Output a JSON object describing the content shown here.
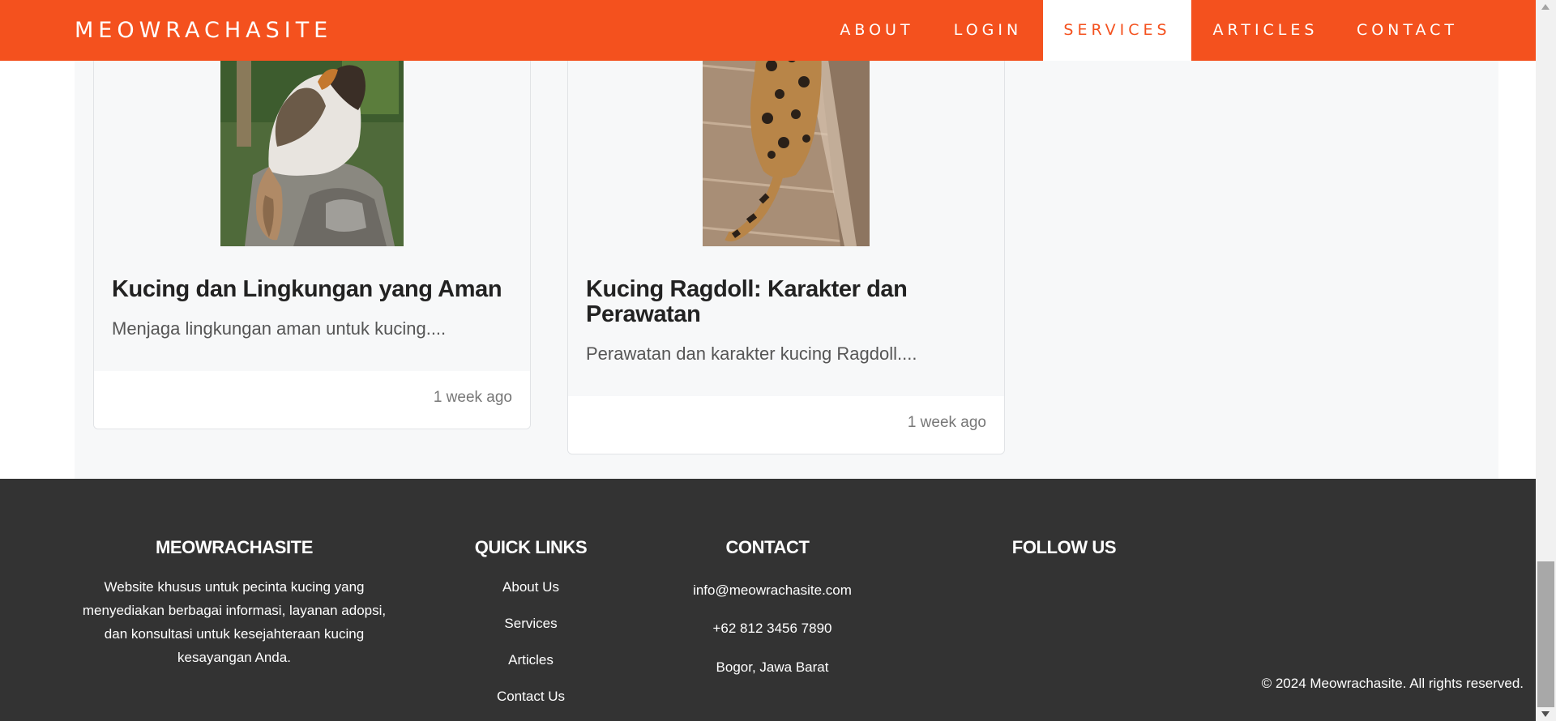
{
  "navbar": {
    "brand": "MEOWRACHASITE",
    "items": [
      {
        "label": "ABOUT",
        "active": false
      },
      {
        "label": "LOGIN",
        "active": false
      },
      {
        "label": "SERVICES",
        "active": true
      },
      {
        "label": "ARTICLES",
        "active": false
      },
      {
        "label": "CONTACT",
        "active": false
      }
    ],
    "color": "#f4511e"
  },
  "articles": [
    {
      "title": "Kucing dan Lingkungan yang Aman",
      "excerpt": "Menjaga lingkungan aman untuk kucing....",
      "time": "1 week ago",
      "image": "calico-cat-photo"
    },
    {
      "title": "Kucing Ragdoll: Karakter dan Perawatan",
      "excerpt": "Perawatan dan karakter kucing Ragdoll....",
      "time": "1 week ago",
      "image": "bengal-cat-photo"
    }
  ],
  "footer": {
    "about": {
      "heading": "MEOWRACHASITE",
      "text": "Website khusus untuk pecinta kucing yang menyediakan berbagai informasi, layanan adopsi, dan konsultasi untuk kesejahteraan kucing kesayangan Anda."
    },
    "quick_links": {
      "heading": "QUICK LINKS",
      "links": [
        "About Us",
        "Services",
        "Articles",
        "Contact Us"
      ]
    },
    "contact": {
      "heading": "CONTACT",
      "email": "info@meowrachasite.com",
      "phone": "+62 812 3456 7890",
      "location": "Bogor, Jawa Barat"
    },
    "follow": {
      "heading": "FOLLOW US"
    },
    "copyright": "© 2024 Meowrachasite. All rights reserved.",
    "background": "#333333"
  }
}
